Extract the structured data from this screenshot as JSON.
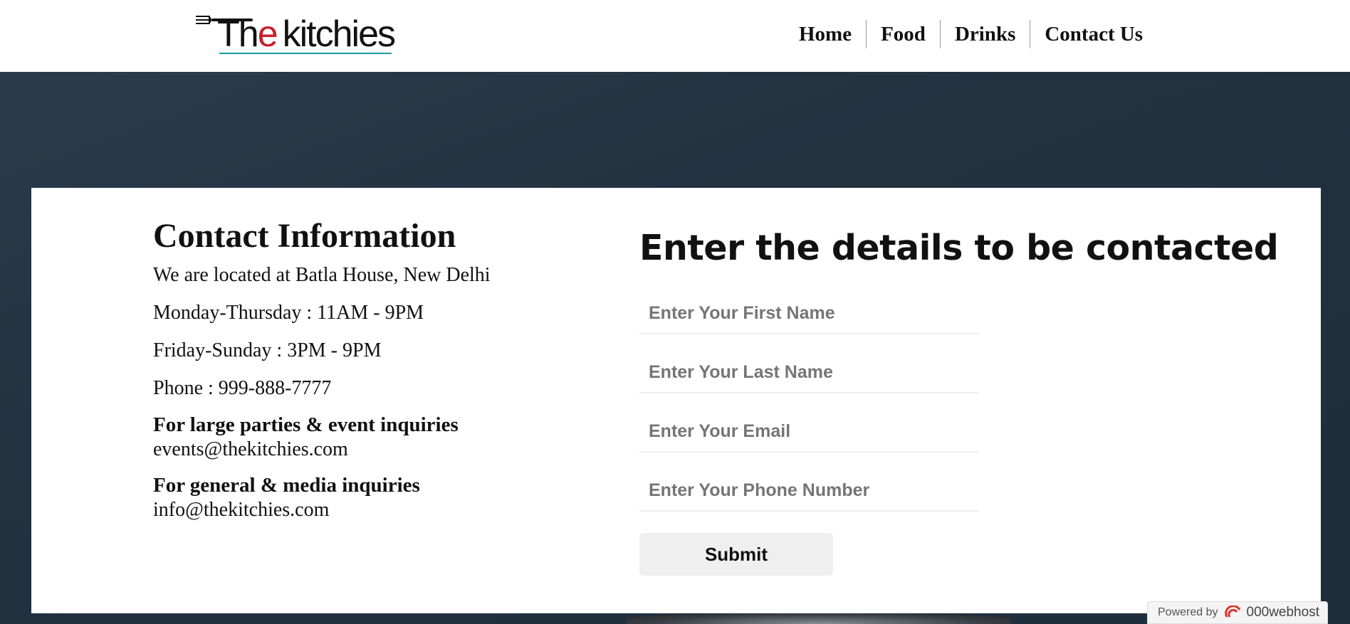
{
  "logo": {
    "the_prefix": "Th",
    "the_e": "e",
    "rest": "kitchies"
  },
  "nav": {
    "items": [
      "Home",
      "Food",
      "Drinks",
      "Contact Us"
    ]
  },
  "contact": {
    "title": "Contact Information",
    "lines": [
      "We are located at Batla House, New Delhi",
      "Monday-Thursday : 11AM - 9PM",
      "Friday-Sunday : 3PM - 9PM",
      "Phone : 999-888-7777"
    ],
    "events_heading": "For large parties & event inquiries",
    "events_email": "events@thekitchies.com",
    "general_heading": "For general & media inquiries",
    "general_email": "info@thekitchies.com"
  },
  "form": {
    "title": "Enter the details to be contacted",
    "first_name_placeholder": "Enter Your First Name",
    "last_name_placeholder": "Enter Your Last Name",
    "email_placeholder": "Enter Your Email",
    "phone_placeholder": "Enter Your Phone Number",
    "submit_label": "Submit"
  },
  "badge": {
    "powered_by": "Powered by",
    "host": "000webhost"
  },
  "colors": {
    "accent_red": "#c8202a",
    "accent_teal": "#1a9aa0",
    "background": "#223241"
  }
}
